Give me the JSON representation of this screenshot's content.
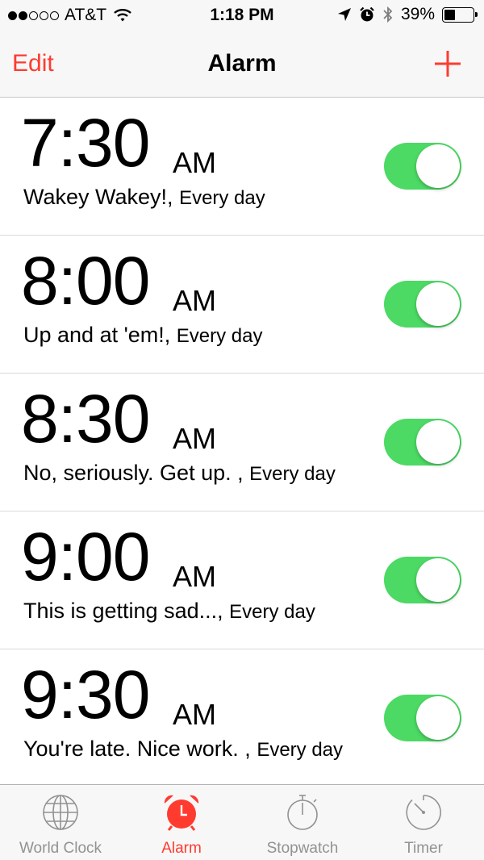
{
  "status_bar": {
    "signal_bars_filled": 2,
    "signal_bars_total": 5,
    "carrier": "AT&T",
    "time": "1:18 PM",
    "battery": "39%",
    "battery_level": 0.39,
    "icons": [
      "wifi-icon",
      "location-arrow-icon",
      "alarm-clock-icon",
      "bluetooth-icon",
      "battery-icon"
    ]
  },
  "nav": {
    "edit_label": "Edit",
    "title": "Alarm",
    "add_icon": "plus-icon"
  },
  "alarms": [
    {
      "time": "7:30",
      "ampm": "AM",
      "label": "Wakey Wakey!,",
      "repeat": "Every day",
      "enabled": true
    },
    {
      "time": "8:00",
      "ampm": "AM",
      "label": "Up and at 'em!,",
      "repeat": "Every day",
      "enabled": true
    },
    {
      "time": "8:30",
      "ampm": "AM",
      "label": "No, seriously. Get up. ,",
      "repeat": "Every day",
      "enabled": true
    },
    {
      "time": "9:00",
      "ampm": "AM",
      "label": "This is getting sad...,",
      "repeat": "Every day",
      "enabled": true
    },
    {
      "time": "9:30",
      "ampm": "AM",
      "label": "You're late. Nice work. ,",
      "repeat": "Every day",
      "enabled": true
    }
  ],
  "tabs": [
    {
      "label": "World Clock",
      "icon": "globe-icon",
      "active": false
    },
    {
      "label": "Alarm",
      "icon": "alarm-clock-icon",
      "active": true
    },
    {
      "label": "Stopwatch",
      "icon": "stopwatch-icon",
      "active": false
    },
    {
      "label": "Timer",
      "icon": "timer-icon",
      "active": false
    }
  ],
  "colors": {
    "accent": "#ff3b30",
    "toggle_on": "#4cd964",
    "tab_inactive": "#929292",
    "bar_background": "#f7f7f7"
  }
}
